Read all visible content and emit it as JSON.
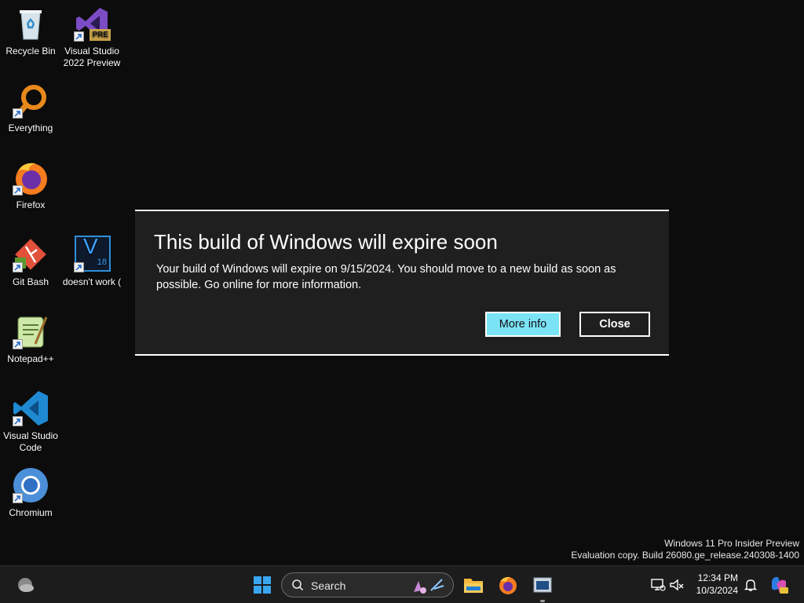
{
  "desktop_icons": [
    {
      "label": "Recycle Bin",
      "icon": "recycle-bin-icon"
    },
    {
      "label": "Visual Studio 2022 Preview",
      "icon": "visual-studio-preview-icon",
      "badge": "PRE"
    },
    {
      "label": "Everything",
      "icon": "everything-search-icon"
    },
    {
      "label": "Firefox",
      "icon": "firefox-icon"
    },
    {
      "label": "Git Bash",
      "icon": "git-bash-icon"
    },
    {
      "label": "doesn't work (",
      "icon": "v18-app-icon",
      "glyph_text": "V",
      "glyph_sub": "18"
    },
    {
      "label": "Notepad++",
      "icon": "notepad-plus-plus-icon"
    },
    {
      "label": "Visual Studio Code",
      "icon": "vscode-icon"
    },
    {
      "label": "Chromium",
      "icon": "chromium-icon"
    }
  ],
  "dialog": {
    "title": "This build of Windows will expire soon",
    "message": "Your build of Windows will expire on 9/15/2024. You should move to a new build as soon as possible. Go online for more information.",
    "primary_button": "More info",
    "secondary_button": "Close"
  },
  "watermark": {
    "line1": "Windows 11 Pro Insider Preview",
    "line2": "Evaluation copy. Build 26080.ge_release.240308-1400"
  },
  "taskbar": {
    "search_placeholder": "Search",
    "pinned": [
      "file-explorer-icon",
      "firefox-icon",
      "app-window-icon"
    ],
    "tray_icons": [
      "network-icon",
      "volume-muted-icon",
      "notification-bell-icon",
      "copilot-icon"
    ],
    "time": "12:34 PM",
    "date": "10/3/2024"
  },
  "colors": {
    "accent_button": "#7be3f6",
    "dialog_bg": "#1f1f1f",
    "taskbar_bg": "#1c1c1c"
  }
}
